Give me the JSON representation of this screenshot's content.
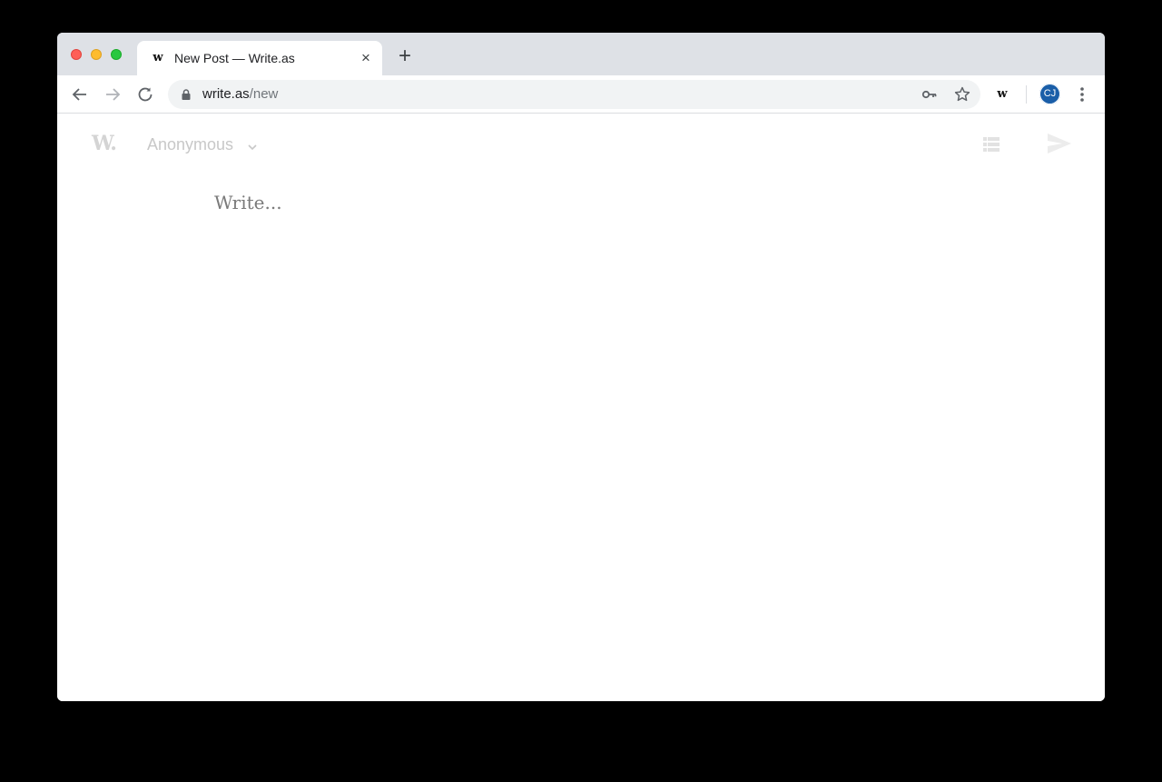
{
  "browser": {
    "tab": {
      "favicon": "w",
      "title": "New Post — Write.as",
      "close_icon": "×"
    },
    "new_tab_icon": "+",
    "toolbar": {
      "back_icon": "arrow-left",
      "forward_icon": "arrow-right",
      "reload_icon": "reload",
      "url_host": "write.as",
      "url_path": "/new",
      "key_icon": "key",
      "star_icon": "star",
      "extension_label": "w",
      "profile_initials": "CJ",
      "profile_color": "#1a5ea8",
      "menu_icon": "more-vertical"
    }
  },
  "page": {
    "logo": "W",
    "logo_dot": ".",
    "author": "Anonymous",
    "editor_placeholder": "Write..."
  }
}
